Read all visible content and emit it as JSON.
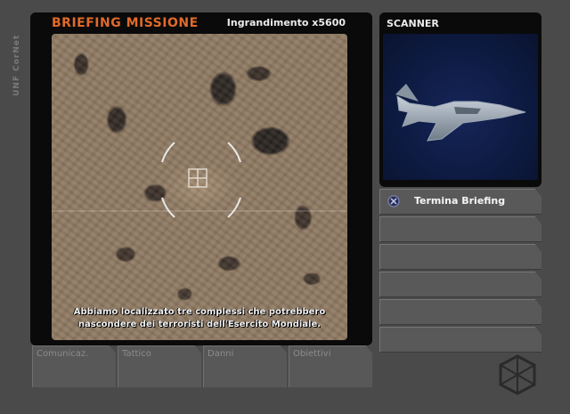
{
  "side_logo": "UNF CorNet",
  "briefing": {
    "title": "BRIEFING MISSIONE",
    "zoom_label": "Ingrandimento x5600",
    "text_line1": "Abbiamo localizzato tre complessi che potrebbero",
    "text_line2": "nascondere dei terroristi dell'Esercito Mondiale."
  },
  "scanner": {
    "title": "SCANNER"
  },
  "menu": {
    "items": [
      {
        "label": "Termina Briefing",
        "icon": "cross-button-icon"
      },
      {
        "label": ""
      },
      {
        "label": ""
      },
      {
        "label": ""
      },
      {
        "label": ""
      },
      {
        "label": ""
      }
    ]
  },
  "tabs": [
    {
      "label": "Comunicaz."
    },
    {
      "label": "Tattico"
    },
    {
      "label": "Danni"
    },
    {
      "label": "Obiettivi"
    }
  ],
  "colors": {
    "title_orange": "#e06a2a",
    "panel_bg": "#0a0a0a",
    "frame_gray": "#4a4a4a",
    "scanner_blue": "#0d1a40"
  }
}
